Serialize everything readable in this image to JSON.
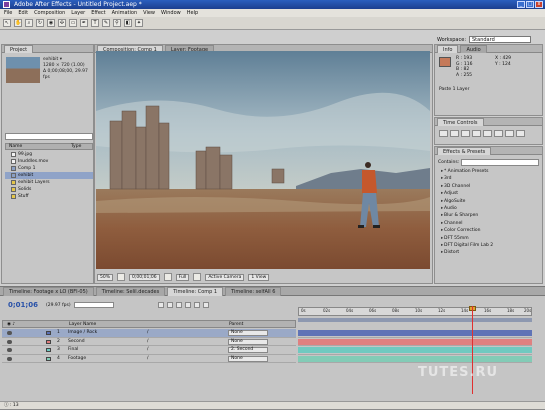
{
  "window": {
    "title": "Adobe After Effects - Untitled Project.aep *",
    "buttons": {
      "min": "_",
      "max": "□",
      "close": "x"
    }
  },
  "menu": [
    "File",
    "Edit",
    "Composition",
    "Layer",
    "Effect",
    "Animation",
    "View",
    "Window",
    "Help"
  ],
  "workspace": {
    "label": "Workspace:",
    "value": "Standard"
  },
  "project": {
    "tab": "Project",
    "info": [
      "exhibit ▾",
      "1280 × 720 (1.00)",
      "Δ 0;00;08;00, 29.97 fps"
    ],
    "columns": [
      "Name",
      "Type"
    ],
    "items": [
      {
        "name": "99.jpg",
        "type": "file"
      },
      {
        "name": "Inuddles.mov",
        "type": "file"
      },
      {
        "name": "Comp 1",
        "type": "comp"
      },
      {
        "name": "exhibit",
        "type": "comp",
        "selected": true
      },
      {
        "name": "exhibit Layers",
        "type": "folder"
      },
      {
        "name": "Solids",
        "type": "folder"
      },
      {
        "name": "Stuff",
        "type": "folder"
      }
    ],
    "footer_depth": "8 bpc"
  },
  "viewer": {
    "tabs": [
      "Composition: Comp 1",
      "Layer: Footage"
    ],
    "footer": [
      "50%",
      "0;00;01;06",
      "Full",
      "Active Camera",
      "1 View"
    ]
  },
  "info": {
    "tabs": [
      "Info",
      "Audio"
    ],
    "rgb": [
      "R : 193",
      "G : 116",
      "B : 82",
      "A : 255"
    ],
    "xy": [
      "X : 429",
      "Y : 124"
    ],
    "layer": "Paste 1 Layer",
    "swatch": "#c57a5a"
  },
  "preview": {
    "tab": "Time Controls"
  },
  "effects": {
    "tab": "Effects & Presets",
    "contains_label": "Contains:",
    "categories": [
      "* Animation Presets",
      "3rd",
      "3D Channel",
      "Adjust",
      "AlgoSuite",
      "Audio",
      "Blur & Sharpen",
      "Channel",
      "Color Correction",
      "DFT 55mm",
      "DFT Digital Film Lab 2",
      "Distort"
    ]
  },
  "timeline": {
    "tabs": [
      "Timeline: Footage x LO (BFI-05)",
      "Timeline: Selil.decades",
      "Timeline: Comp 1",
      "Timeline: selfAll 6"
    ],
    "timecode": "0;01;06",
    "fps": "(29.97 fps)",
    "columns": {
      "label": "Layer Name",
      "parent": "Parent"
    },
    "layers": [
      {
        "num": "1",
        "name": "Image / Rock",
        "parent": "None",
        "color": "#5a6fb5",
        "selected": true
      },
      {
        "num": "2",
        "name": "Second",
        "parent": "None",
        "color": "#e07c7c"
      },
      {
        "num": "3",
        "name": "Final",
        "parent": "2. Second",
        "color": "#6cc9c0"
      },
      {
        "num": "4",
        "name": "Footage",
        "parent": "None",
        "color": "#7fcbb5"
      }
    ],
    "ruler_ticks": [
      "0s",
      "02s",
      "04s",
      "06s",
      "08s",
      "10s",
      "12s",
      "14s",
      "16s",
      "18s",
      "20s"
    ],
    "cti_position": 0.74
  },
  "status": "ⓘ : 13",
  "watermark": "TUTES.RU"
}
